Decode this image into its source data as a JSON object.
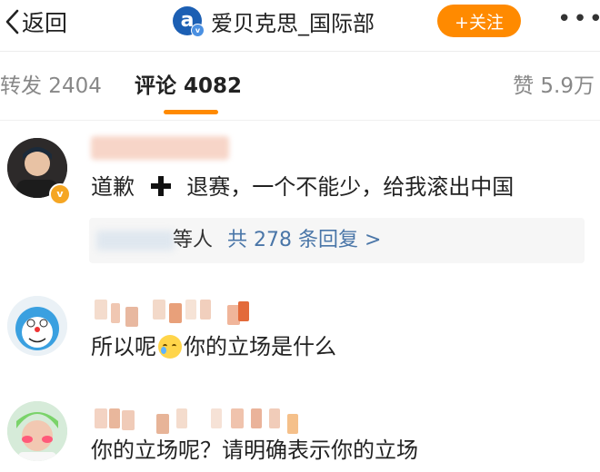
{
  "header": {
    "back_label": "返回",
    "account_name": "爱贝克思_国际部",
    "follow_label": "+关注",
    "more_label": "•••"
  },
  "tabs": {
    "repost_label": "转发 2404",
    "comment_label": "评论 4082",
    "like_label": "赞 5.9万"
  },
  "comments": [
    {
      "text_before": "道歉",
      "text_after": "退赛，一个不能少，给我滚出中国",
      "reply_suffix": "等人",
      "reply_link": "共 278 条回复 >"
    },
    {
      "text_before": "所以呢",
      "text_after": "你的立场是什么"
    },
    {
      "text": "你的立场呢？请明确表示你的立场"
    }
  ],
  "colors": {
    "accent": "#ff8a00",
    "link": "#4a76a8",
    "brand": "#1c5fb3"
  },
  "icons": [
    "back-chevron-icon",
    "account-logo-icon",
    "verified-icon",
    "more-dots-icon",
    "vip-badge-icon",
    "plus-icon",
    "crying-emoji-icon"
  ]
}
